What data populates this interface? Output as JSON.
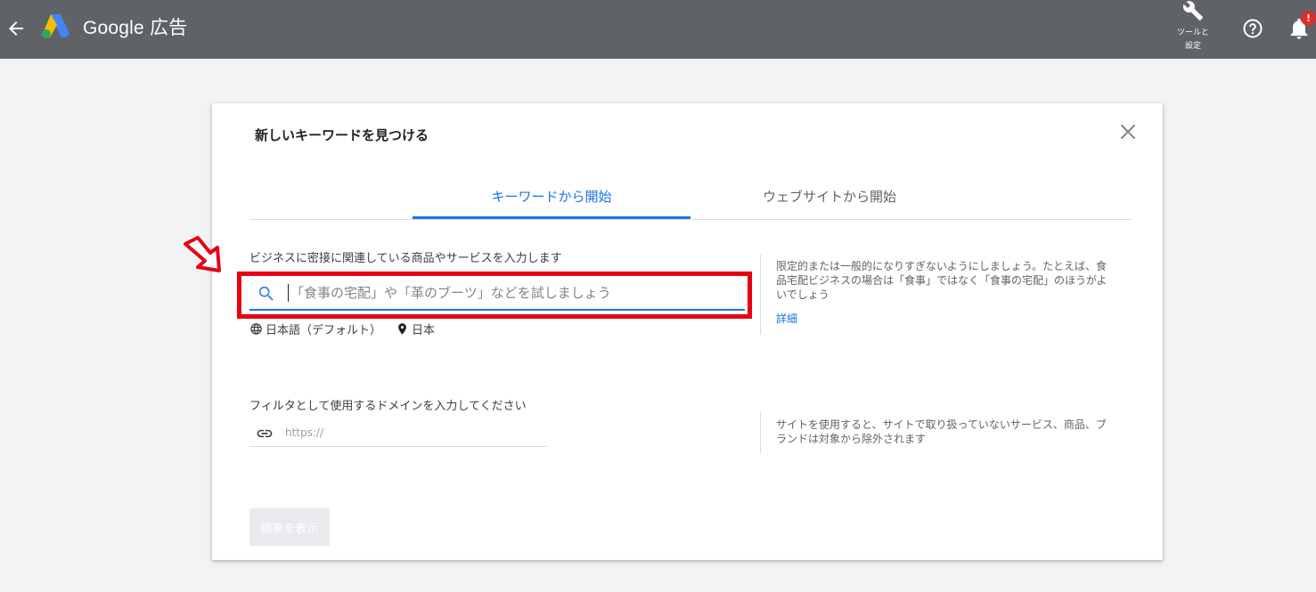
{
  "header": {
    "brand": "Google 広告",
    "tools_label_line1": "ツールと",
    "tools_label_line2": "設定",
    "notification_badge": "!"
  },
  "dialog": {
    "title": "新しいキーワードを見つける",
    "tabs": [
      {
        "label": "キーワードから開始",
        "active": true
      },
      {
        "label": "ウェブサイトから開始",
        "active": false
      }
    ],
    "keyword_section": {
      "label": "ビジネスに密接に関連している商品やサービスを入力します",
      "placeholder": "「食事の宅配」や「革のブーツ」などを試しましょう",
      "value": "",
      "language": "日本語（デフォルト）",
      "location": "日本",
      "hint": "限定的または一般的になりすぎないようにしましょう。たとえば、食品宅配ビジネスの場合は「食事」ではなく「食事の宅配」のほうがよいでしょう",
      "detail_link": "詳細"
    },
    "domain_section": {
      "label": "フィルタとして使用するドメインを入力してください",
      "placeholder": "https://",
      "value": "",
      "hint": "サイトを使用すると、サイトで取り扱っていないサービス、商品、ブランドは対象から除外されます"
    },
    "submit_label": "結果を表示"
  },
  "colors": {
    "topbar": "#5f6368",
    "accent": "#1a73e8",
    "highlight": "#e60012",
    "background": "#f1f3f4"
  },
  "icons": [
    "back-arrow-icon",
    "google-ads-logo",
    "wrench-icon",
    "help-icon",
    "bell-icon",
    "close-icon",
    "search-icon",
    "globe-icon",
    "location-pin-icon",
    "link-icon",
    "pointer-arrow-icon"
  ]
}
